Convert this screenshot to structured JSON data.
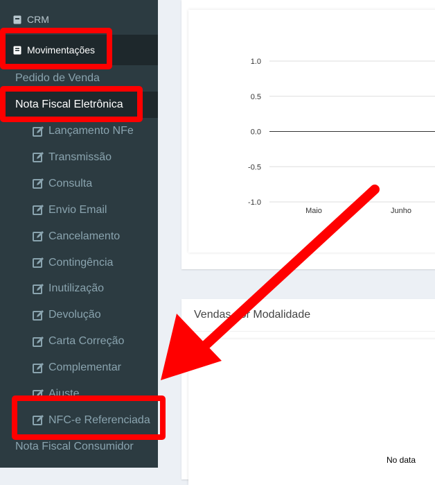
{
  "sidebar": {
    "crm_label": "CRM",
    "movimentacoes_label": "Movimentações",
    "pedido_venda": "Pedido de Venda",
    "nota_fiscal_eletronica": "Nota Fiscal Eletrônica",
    "nfe_items": [
      "Lançamento NFe",
      "Transmissão",
      "Consulta",
      "Envio Email",
      "Cancelamento",
      "Contingência",
      "Inutilização",
      "Devolução",
      "Carta Correção",
      "Complementar",
      "Ajuste",
      "NFC-e Referenciada"
    ],
    "nota_fiscal_consumidor": "Nota Fiscal Consumidor"
  },
  "chart_data": {
    "type": "line",
    "categories": [
      "Maio",
      "Junho"
    ],
    "series": [
      {
        "values": [
          0,
          0
        ]
      }
    ],
    "ylim": [
      -1.0,
      1.0
    ],
    "yticks": [
      "1.0",
      "0.5",
      "0.0",
      "-0.5",
      "-1.0"
    ],
    "grid": true
  },
  "card2": {
    "title": "Vendas por Modalidade",
    "no_data": "No data"
  },
  "colors": {
    "sidebar_bg": "#2c3b41",
    "sidebar_active_bg": "#1e282c",
    "highlight": "#ff0000"
  }
}
